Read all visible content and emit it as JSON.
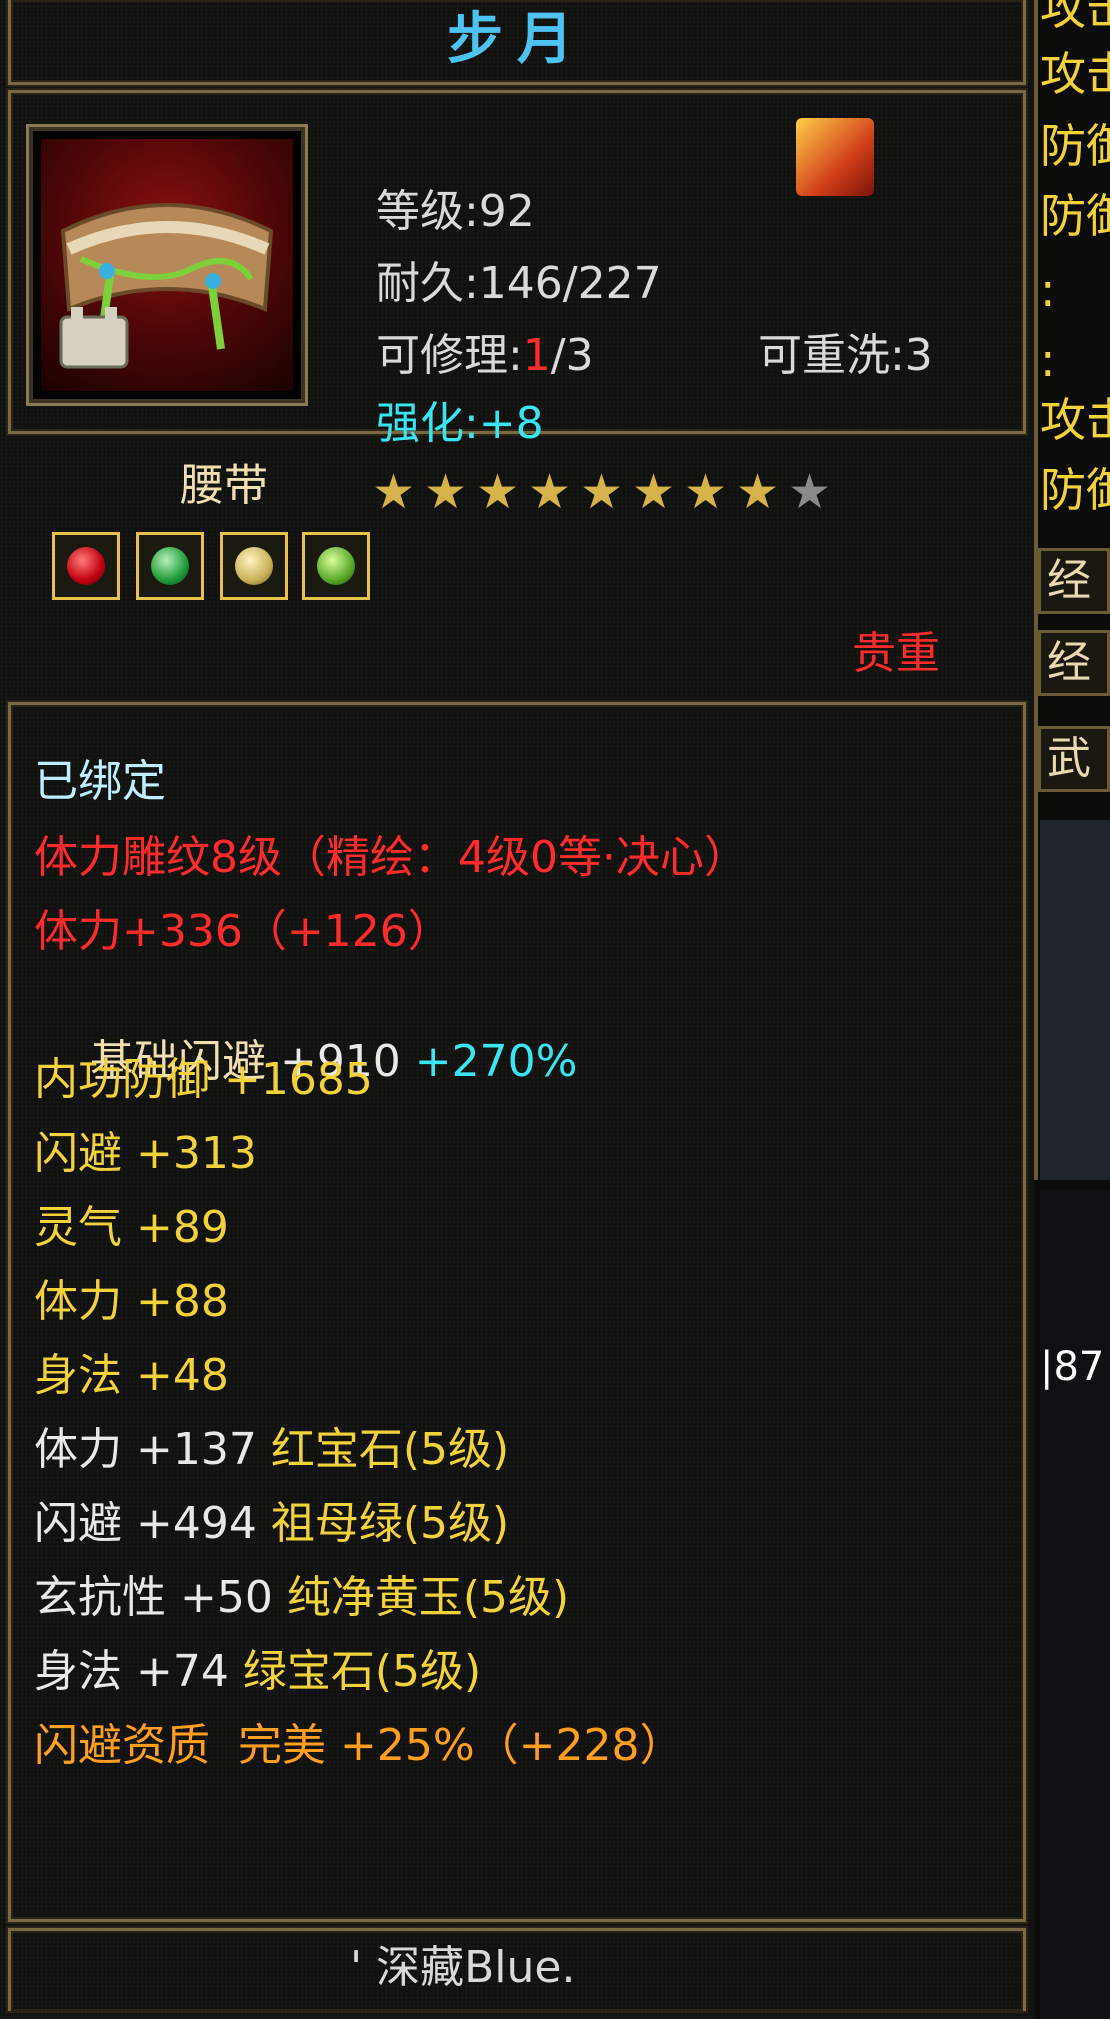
{
  "item": {
    "name": "步月",
    "level_label": "等级:",
    "level": "92",
    "durability_label": "耐久:",
    "durability": "146/227",
    "repair_label": "可修理:",
    "repair_used": "1",
    "repair_total": "/3",
    "rewash_label": "可重洗:",
    "rewash": "3",
    "enhance_label": "强化:",
    "enhance": "+8",
    "type": "腰带",
    "stars_filled": 8,
    "stars_total": 9,
    "rarity": "贵重",
    "bound": "已绑定",
    "carving": "体力雕纹8级（精绘：4级0等·决心）",
    "carving_stat": "体力+336（+126）",
    "base_stat_label": "基础闪避 ",
    "base_stat_value": "+910 ",
    "base_stat_bonus": "+270%",
    "stats": [
      {
        "label": "内功防御 ",
        "value": "+1685"
      },
      {
        "label": "闪避 ",
        "value": "+313"
      },
      {
        "label": "灵气 ",
        "value": "+89"
      },
      {
        "label": "体力 ",
        "value": "+88"
      },
      {
        "label": "身法 ",
        "value": "+48"
      }
    ],
    "gem_stats": [
      {
        "label": "体力 ",
        "value": "+137 ",
        "gem": "红宝石(5级)"
      },
      {
        "label": "闪避 ",
        "value": "+494 ",
        "gem": "祖母绿(5级)"
      },
      {
        "label": "玄抗性 ",
        "value": "+50 ",
        "gem": "纯净黄玉(5级)"
      },
      {
        "label": "身法 ",
        "value": "+74 ",
        "gem": "绿宝石(5级)"
      }
    ],
    "quality_line": "闪避资质  完美 +25%（+228）",
    "owner": "' 深藏Blue."
  },
  "gems_icons": [
    "ruby-gem-icon",
    "emerald-gem-icon",
    "topaz-gem-icon",
    "green-gem-icon"
  ],
  "colors": {
    "title": "#4ec3f2",
    "red": "#ff2b2b",
    "cyan": "#38e5f0",
    "yellow": "#f2d23a",
    "orange": "#ff9e1f"
  },
  "side_panel": {
    "lines": [
      "攻击",
      "攻击",
      "防御",
      "防御",
      ":",
      ":",
      "攻击",
      "防御"
    ],
    "buttons": [
      "经",
      "经",
      "武"
    ],
    "number": "|87"
  }
}
